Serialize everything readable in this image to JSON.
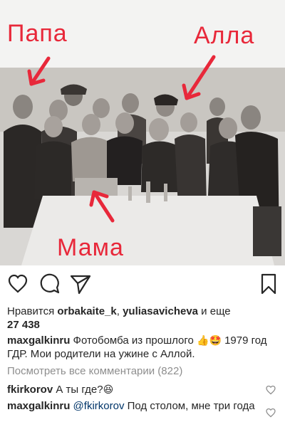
{
  "photo": {
    "label_papa": "Папа",
    "label_alla": "Алла",
    "label_mama": "Мама",
    "annotation_color": "#e8283a"
  },
  "actions": {
    "like_icon": "heart-icon",
    "comment_icon": "comment-icon",
    "share_icon": "paper-plane-icon",
    "save_icon": "bookmark-icon"
  },
  "likes": {
    "prefix": "Нравится ",
    "user1": "orbakaite_k",
    "sep": ", ",
    "user2": "yuliasavicheva",
    "and_more": " и еще",
    "count": "27 438"
  },
  "caption": {
    "username": "maxgalkinru",
    "text_part1": " Фотобомба из прошлого ",
    "emoji1": "👍",
    "emoji2": "🤩",
    "text_part2": " 1979 год ГДР. Мои родители на ужине с Аллой."
  },
  "view_comments": "Посмотреть все комментарии (822)",
  "comments": [
    {
      "username": "fkirkorov",
      "text": " А ты где?",
      "emoji": "😆"
    },
    {
      "username": "maxgalkinru",
      "mention": "@fkirkorov",
      "text": " Под столом, мне три года"
    }
  ]
}
